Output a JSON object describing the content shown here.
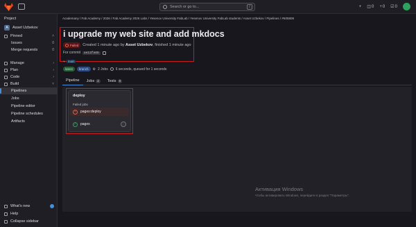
{
  "topbar": {
    "search_placeholder": "Search or go to...",
    "shortcut": "/",
    "plus": "+",
    "issues_count": "0",
    "mr_count": "0",
    "todo_count": "0"
  },
  "sidebar": {
    "header": "Project",
    "project_initial": "A",
    "project_name": "Asset Uzbekov",
    "pinned": "Pinned",
    "issues": "Issues",
    "issues_count": "0",
    "merge_requests": "Merge requests",
    "mr_count": "0",
    "manage": "Manage",
    "plan": "Plan",
    "code": "Code",
    "build": "Build",
    "pipelines": "Pipelines",
    "jobs": "Jobs",
    "pipeline_editor": "Pipeline editor",
    "pipeline_schedules": "Pipeline schedules",
    "artifacts": "Artifacts",
    "whats_new": "What's new",
    "help": "Help",
    "collapse": "Collapse sidebar"
  },
  "breadcrumb": "Academany / Fab Academy / 2026 / Fab Academy 2026 Labs / Yesenov University FabLab / Yesenov University FabLab students / Asset Uzbekov / Pipelines / #605808",
  "pipeline": {
    "title": "i upgrade my web site and add mkdocs",
    "status": "Failed",
    "created_prefix": "Created 1 minute ago by",
    "author": "Asset Uzbekov",
    "created_suffix": ", finished 1 minute ago",
    "commit_label": "For commit",
    "commit_sha": "ae12fa65",
    "branch": "main",
    "tag_latest": "latest",
    "tag_branch": "branch",
    "jobs_count": "2 Jobs",
    "duration": "6 seconds, queued for 1 seconds"
  },
  "tabs": [
    {
      "label": "Pipeline"
    },
    {
      "label": "Jobs",
      "count": "2"
    },
    {
      "label": "Tests",
      "count": "0"
    }
  ],
  "stage": {
    "name": "deploy",
    "failed_jobs_label": "Failed jobs",
    "failed_job": "pages:deploy",
    "job": "pages"
  },
  "watermark": {
    "title": "Активация Windows",
    "body": "Чтобы активировать Windows, перейдите в раздел \"Параметры\"."
  },
  "colors": {
    "failed": "#ec5941",
    "success": "#2da160",
    "accent": "#428fdc",
    "highlight_box": "#c91c1c"
  }
}
